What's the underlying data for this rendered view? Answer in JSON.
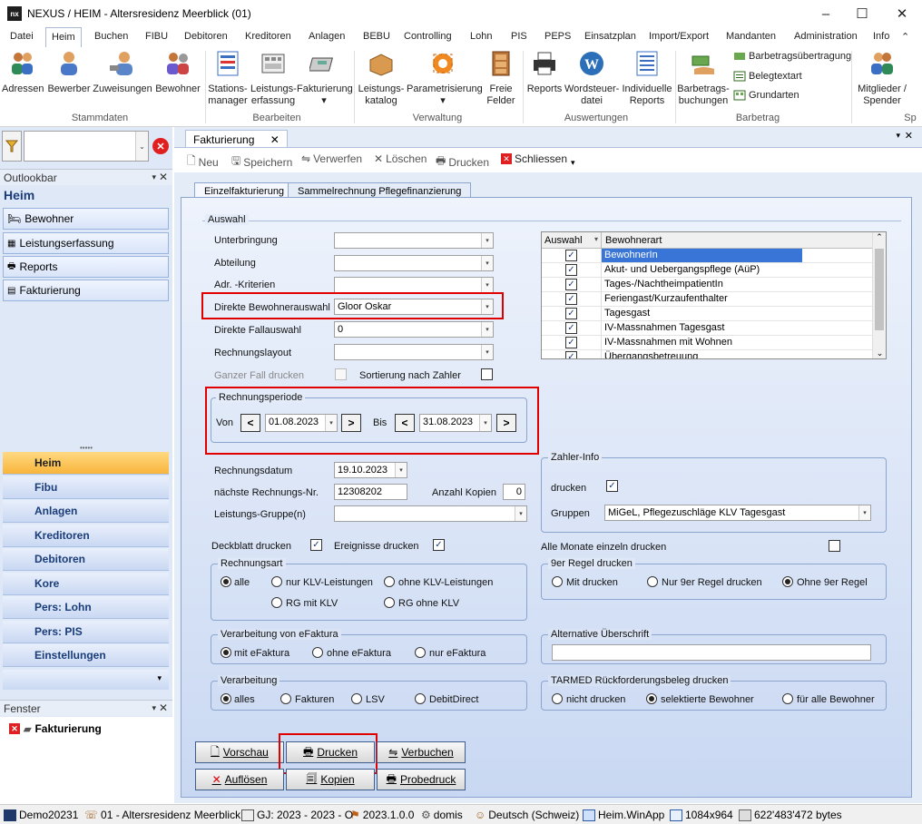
{
  "window": {
    "title": "NEXUS / HEIM - Altersresidenz Meerblick (01)",
    "app_icon": "nx"
  },
  "menu": [
    "Datei",
    "Heim",
    "Buchen",
    "FIBU",
    "Debitoren",
    "Kreditoren",
    "Anlagen",
    "BEBU",
    "Controlling",
    "Lohn",
    "PIS",
    "PEPS",
    "Einsatzplan",
    "Import/Export",
    "Mandanten",
    "Administration",
    "Info"
  ],
  "ribbon": {
    "buttons": [
      {
        "label": "Adressen"
      },
      {
        "label": "Bewerber"
      },
      {
        "label": "Zuweisungen"
      },
      {
        "label": "Bewohner"
      },
      {
        "label": "Stations-\nmanager"
      },
      {
        "label": "Leistungs-\nerfassung"
      },
      {
        "label": "Fakturierung"
      },
      {
        "label": "Leistungs-\nkatalog"
      },
      {
        "label": "Parametrisierung"
      },
      {
        "label": "Freie\nFelder"
      },
      {
        "label": "Reports"
      },
      {
        "label": "Wordsteuer-\ndatei"
      },
      {
        "label": "Individuelle\nReports"
      },
      {
        "label": "Barbetrags-\nbuchungen"
      },
      {
        "label": "Mitglieder /\nSpender"
      }
    ],
    "small": [
      "Barbetragsübertragung",
      "Belegtextart",
      "Grundarten"
    ],
    "groups": [
      "Stammdaten",
      "Bearbeiten",
      "Verwaltung",
      "Auswertungen",
      "Barbetrag",
      "Sp"
    ]
  },
  "outlookbar": {
    "title": "Outlookbar",
    "section": "Heim",
    "items": [
      "Bewohner",
      "Leistungserfassung",
      "Reports",
      "Fakturierung"
    ],
    "nav": [
      "Heim",
      "Fibu",
      "Anlagen",
      "Kreditoren",
      "Debitoren",
      "Kore",
      "Pers: Lohn",
      "Pers: PIS",
      "Einstellungen"
    ],
    "fenster_title": "Fenster",
    "fenster_item": "Fakturierung"
  },
  "doc": {
    "tab": "Fakturierung",
    "toolbar": {
      "neu": "Neu",
      "speichern": "Speichern",
      "verwerfen": "Verwerfen",
      "loeschen": "Löschen",
      "drucken": "Drucken",
      "schliessen": "Schliessen"
    },
    "subtabs": [
      "Einzelfakturierung",
      "Sammelrechnung Pflegefinanzierung"
    ]
  },
  "form": {
    "auswahl_title": "Auswahl",
    "unterbringung": "Unterbringung",
    "abteilung": "Abteilung",
    "adr_kriterien": "Adr. -Kriterien",
    "direkte_bewohnerauswahl": "Direkte Bewohnerauswahl",
    "direkte_bewohnerauswahl_value": "Gloor Oskar",
    "direkte_fallauswahl": "Direkte Fallauswahl",
    "direkte_fallauswahl_value": "0",
    "rechnungslayout": "Rechnungslayout",
    "ganzer_fall": "Ganzer Fall drucken",
    "sortierung": "Sortierung nach Zahler",
    "rechnungsperiode": "Rechnungsperiode",
    "von": "Von",
    "von_value": "01.08.2023",
    "bis": "Bis",
    "bis_value": "31.08.2023",
    "rechnungsdatum": "Rechnungsdatum",
    "rechnungsdatum_value": "19.10.2023",
    "naechste_nr": "nächste Rechnungs-Nr.",
    "naechste_nr_value": "12308202",
    "anzahl_kopien": "Anzahl Kopien",
    "anzahl_kopien_value": "0",
    "leistungsgruppe": "Leistungs-Gruppe(n)",
    "deckblatt": "Deckblatt drucken",
    "ereignisse": "Ereignisse drucken",
    "zahler_info": "Zahler-Info",
    "zahler_drucken": "drucken",
    "gruppen": "Gruppen",
    "gruppen_value": "MiGeL, Pflegezuschläge KLV Tagesgast",
    "alle_monate": "Alle Monate einzeln drucken",
    "rechnungsart": "Rechnungsart",
    "ra_alle": "alle",
    "ra_nur_klv": "nur KLV-Leistungen",
    "ra_ohne_klv": "ohne KLV-Leistungen",
    "ra_rg_mit": "RG mit KLV",
    "ra_rg_ohne": "RG ohne KLV",
    "regel9": "9er Regel drucken",
    "r9_mit": "Mit drucken",
    "r9_nur": "Nur 9er Regel drucken",
    "r9_ohne": "Ohne 9er Regel",
    "efaktura": "Verarbeitung von eFaktura",
    "ef_mit": "mit eFaktura",
    "ef_ohne": "ohne eFaktura",
    "ef_nur": "nur eFaktura",
    "alt_ueberschrift": "Alternative Überschrift",
    "verarbeitung": "Verarbeitung",
    "v_alles": "alles",
    "v_fakturen": "Fakturen",
    "v_lsv": "LSV",
    "v_debit": "DebitDirect",
    "tarmed": "TARMED Rückforderungsbeleg drucken",
    "t_nicht": "nicht drucken",
    "t_sel": "selektierte Bewohner",
    "t_alle": "für alle Bewohner"
  },
  "grid": {
    "headers": [
      "Auswahl",
      "Bewohnerart"
    ],
    "rows": [
      "BewohnerIn",
      "Akut- und Uebergangspflege (AüP)",
      "Tages-/NachtheimpatientIn",
      "Feriengast/Kurzaufenthalter",
      "Tagesgast",
      "IV-Massnahmen Tagesgast",
      "IV-Massnahmen mit Wohnen",
      "Übergangsbetreuung"
    ]
  },
  "buttons": {
    "vorschau": "Vorschau",
    "drucken": "Drucken",
    "verbuchen": "Verbuchen",
    "aufloesen": "Auflösen",
    "kopien": "Kopien",
    "probedruck": "Probedruck"
  },
  "status": [
    "Demo20231",
    "01 - Altersresidenz Meerblick",
    "GJ: 2023 - 2023 - O",
    "2023.1.0.0",
    "domis",
    "Deutsch (Schweiz)",
    "Heim.WinApp",
    "1084x964",
    "622'483'472 bytes"
  ]
}
